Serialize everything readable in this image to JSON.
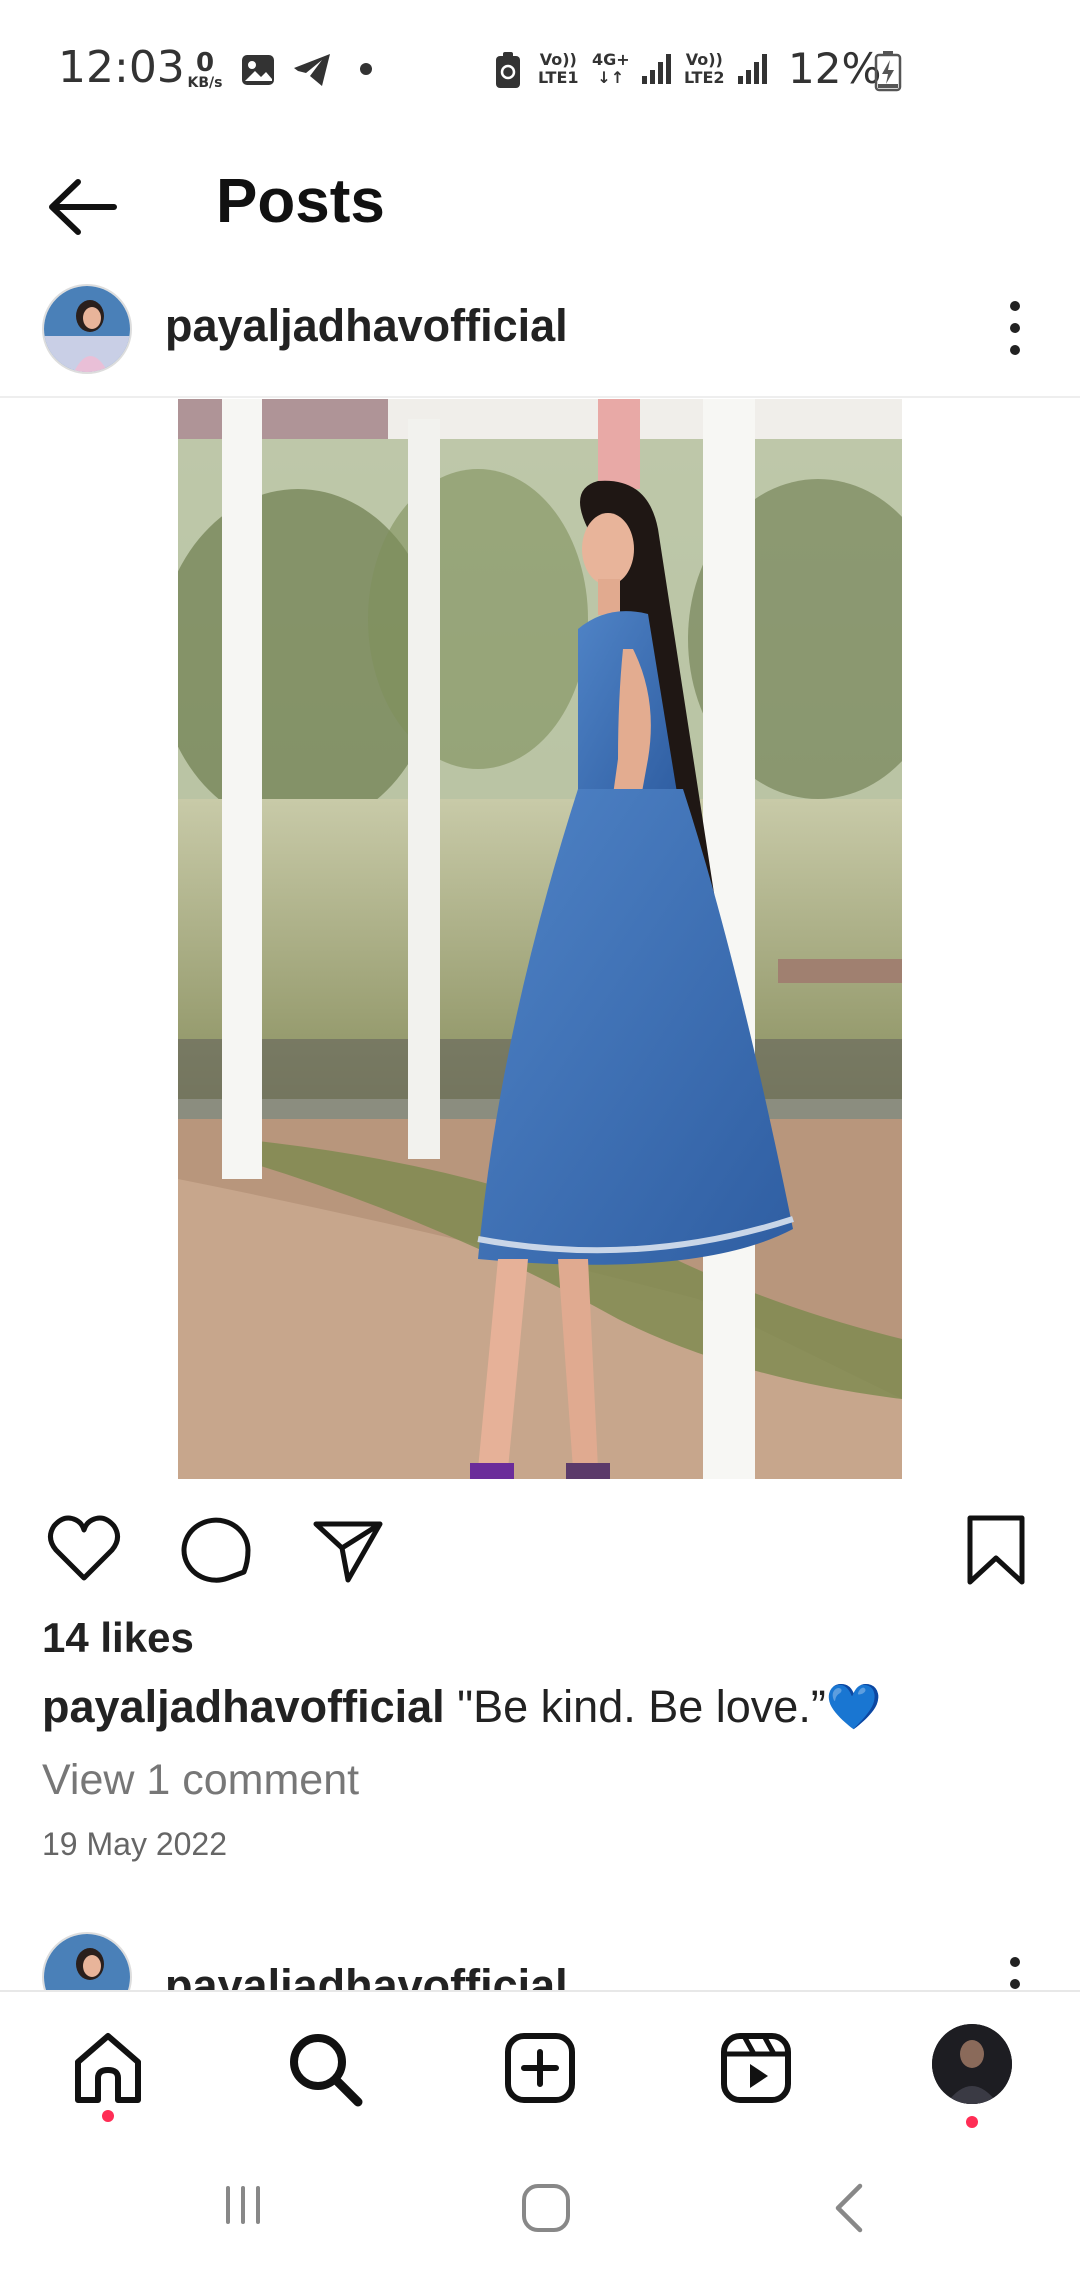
{
  "status_bar": {
    "time": "12:03",
    "net_speed_value": "0",
    "net_speed_unit": "KB/s",
    "sim1_top": "Vo))",
    "sim1_bottom": "LTE1",
    "net_type": "4G+",
    "sim2_top": "Vo))",
    "sim2_bottom": "LTE2",
    "battery_percent": "12%"
  },
  "header": {
    "title": "Posts"
  },
  "post": {
    "username": "payaljadhavofficial",
    "likes": "14 likes",
    "caption_user": "payaljadhavofficial",
    "caption_text": " \"Be kind. Be love.”",
    "caption_emoji": "💙",
    "view_comments": "View 1 comment",
    "date": "19 May 2022"
  },
  "next_post": {
    "username": "payaljadhavofficial"
  },
  "colors": {
    "notification_dot": "#ff2d55",
    "dress_blue": "#3b6fb6"
  },
  "icons": {
    "back": "arrow-left-icon",
    "more": "more-vertical-icon",
    "like": "heart-icon",
    "comment": "comment-icon",
    "share": "send-icon",
    "save": "bookmark-icon",
    "home": "home-icon",
    "search": "search-icon",
    "create": "plus-square-icon",
    "reels": "reels-icon",
    "recents": "recents-icon",
    "home_sys": "home-circle-icon",
    "back_sys": "chevron-left-icon"
  }
}
